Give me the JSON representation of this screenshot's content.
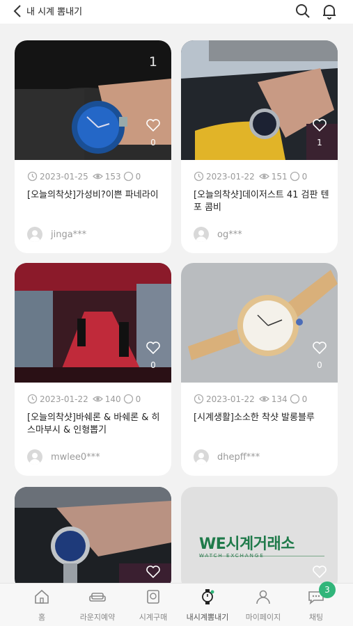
{
  "header": {
    "title": "내 시계 뽐내기",
    "back_icon": "chevron-left-icon",
    "search_icon": "search-icon",
    "bell_icon": "bell-icon"
  },
  "posts": [
    {
      "date": "2023-01-25",
      "views": "153",
      "comments": "0",
      "title": "[오늘의착샷]가성비?이쁜 파네라이",
      "author": "jinga***",
      "likes": "0",
      "image_count": "1"
    },
    {
      "date": "2023-01-22",
      "views": "151",
      "comments": "0",
      "title": "[오늘의착샷]데이저스트 41 검판 텐포 콤비",
      "author": "og***",
      "likes": "1"
    },
    {
      "date": "2023-01-22",
      "views": "140",
      "comments": "0",
      "title": "[오늘의착샷]바쉐론 & 바쉐론 & 히스마부시 & 인형뽑기",
      "author": "mwlee0***",
      "likes": "0"
    },
    {
      "date": "2023-01-22",
      "views": "134",
      "comments": "0",
      "title": "[시계생활]소소한 착샷 발롱블루",
      "author": "dhepff***",
      "likes": "0"
    }
  ],
  "banner": {
    "brand": "WE시계거래소",
    "sub": "WATCH EXCHANGE"
  },
  "nav": [
    {
      "label": "홈",
      "icon": "home-icon"
    },
    {
      "label": "라운지예약",
      "icon": "sofa-icon"
    },
    {
      "label": "시계구매",
      "icon": "watch-box-icon"
    },
    {
      "label": "내시계뽐내기",
      "icon": "watch-icon",
      "active": true
    },
    {
      "label": "마이페이지",
      "icon": "user-icon"
    },
    {
      "label": "채팅",
      "icon": "chat-icon"
    }
  ],
  "chat_badge": "3",
  "colors": {
    "accent": "#31b57a",
    "brand_green": "#1f7a4a",
    "background": "#f2f2f2"
  }
}
